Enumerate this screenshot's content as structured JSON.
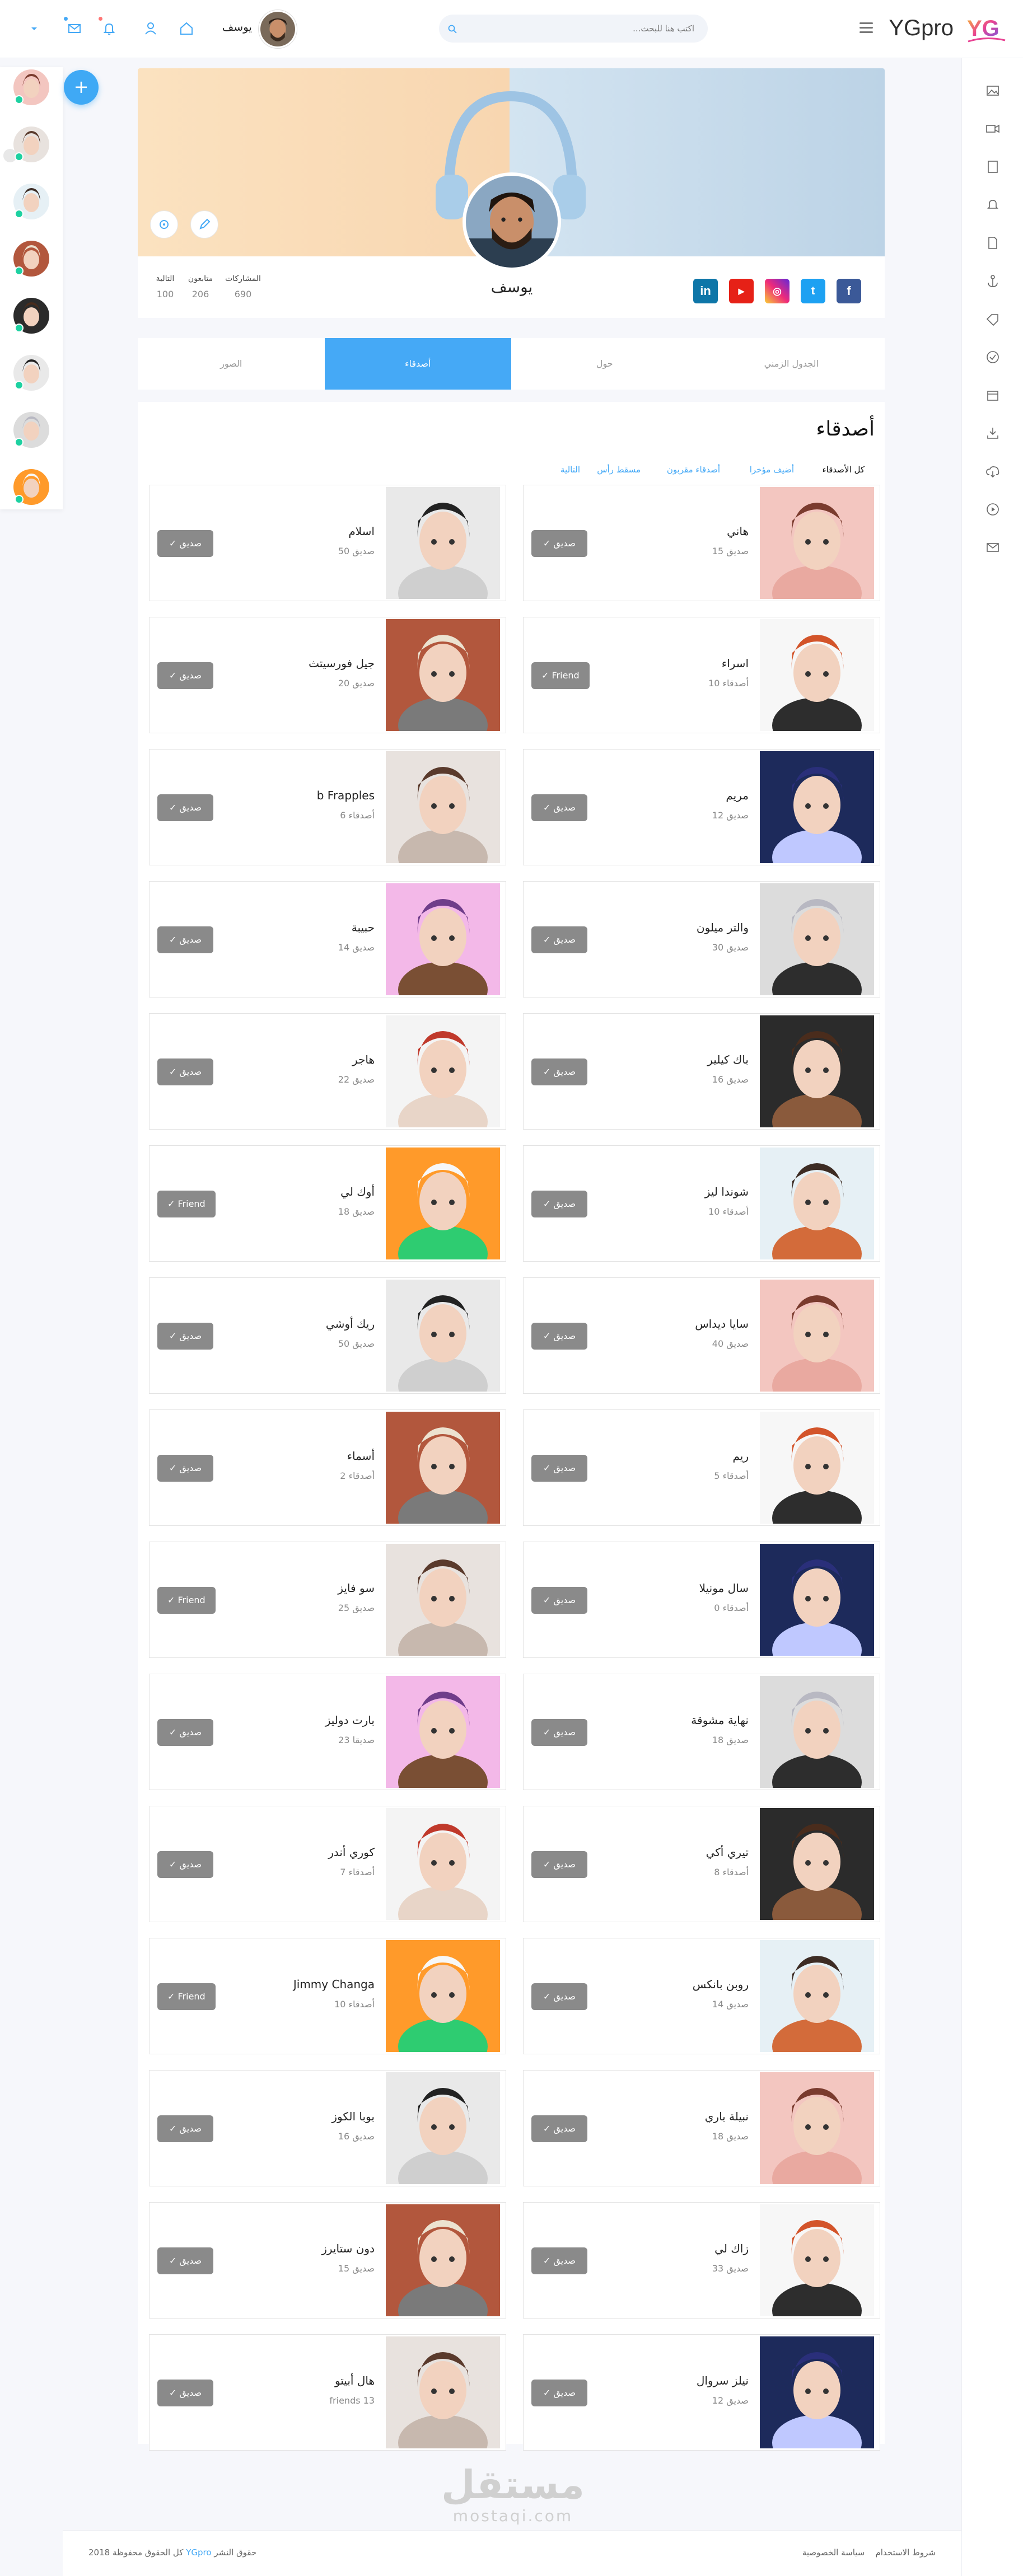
{
  "brand": {
    "name": "YGpro",
    "logo_letters": "YG"
  },
  "search": {
    "placeholder": "اكتب هنا للبحث..."
  },
  "top_user": {
    "name": "يوسف"
  },
  "profile": {
    "name": "يوسف",
    "stats": [
      {
        "label": "المشاركات",
        "value": "690"
      },
      {
        "label": "متابعون",
        "value": "206"
      },
      {
        "label": "التالية",
        "value": "100"
      }
    ],
    "socials": [
      "linkedin-icon",
      "youtube-icon",
      "instagram-icon",
      "twitter-icon",
      "facebook-icon"
    ]
  },
  "tabs": [
    {
      "label": "الجدول الزمني"
    },
    {
      "label": "حول"
    },
    {
      "label": "أصدقاء"
    },
    {
      "label": "الصور"
    }
  ],
  "friends": {
    "title": "أصدقاء",
    "filters": [
      {
        "label": "كل الأصدقاء"
      },
      {
        "label": "أضيف مؤخرا"
      },
      {
        "label": "أصدقاء مقربون"
      },
      {
        "label": "مسقط رأس"
      },
      {
        "label": "التالية"
      }
    ],
    "cards": [
      {
        "name": "هاني",
        "count": "15 صديق",
        "button": "صديق"
      },
      {
        "name": "اسلام",
        "count": "50 صديق",
        "button": "صديق"
      },
      {
        "name": "اسراء",
        "count": "10 أصدقاء",
        "button": "Friend"
      },
      {
        "name": "جيل فورسيتث",
        "count": "20 صديق",
        "button": "صديق"
      },
      {
        "name": "مريم",
        "count": "12 صديق",
        "button": "صديق"
      },
      {
        "name": "b Frapples",
        "count": "6 أصدقاء",
        "button": "صديق"
      },
      {
        "name": "والتر ميلون",
        "count": "30 صديق",
        "button": "صديق"
      },
      {
        "name": "حبيبة",
        "count": "14 صديق",
        "button": "صديق"
      },
      {
        "name": "باك كيلير",
        "count": "16 صديق",
        "button": "صديق"
      },
      {
        "name": "هاجر",
        "count": "22 صديق",
        "button": "صديق"
      },
      {
        "name": "شوندا ليز",
        "count": "10 أصدقاء",
        "button": "صديق"
      },
      {
        "name": "أوك لي",
        "count": "18 صديق",
        "button": "Friend"
      },
      {
        "name": "سايا ديداس",
        "count": "40 صديق",
        "button": "صديق"
      },
      {
        "name": "ريك أوشي",
        "count": "50 صديق",
        "button": "صديق"
      },
      {
        "name": "ريم",
        "count": "5 أصدقاء",
        "button": "صديق"
      },
      {
        "name": "أسماء",
        "count": "2 أصدقاء",
        "button": "صديق"
      },
      {
        "name": "سال مونيلا",
        "count": "0 أصدقاء",
        "button": "صديق"
      },
      {
        "name": "سو فايز",
        "count": "25 صديق",
        "button": "Friend"
      },
      {
        "name": "نهاية مشوقة",
        "count": "18 صديق",
        "button": "صديق"
      },
      {
        "name": "بارت دوليز",
        "count": "23 صديقا",
        "button": "صديق"
      },
      {
        "name": "تيري أكي",
        "count": "8 أصدقاء",
        "button": "صديق"
      },
      {
        "name": "كوري أندر",
        "count": "7 أصدقاء",
        "button": "صديق"
      },
      {
        "name": "روبن بانكس",
        "count": "14 صديق",
        "button": "صديق"
      },
      {
        "name": "Jimmy Changa",
        "count": "10 أصدقاء",
        "button": "Friend"
      },
      {
        "name": "نبيلة باري",
        "count": "18 صديق",
        "button": "صديق"
      },
      {
        "name": "بوبا الكوز",
        "count": "16 صديق",
        "button": "صديق"
      },
      {
        "name": "زاك لي",
        "count": "33 صديق",
        "button": "صديق"
      },
      {
        "name": "دون ستايرز",
        "count": "15 صديق",
        "button": "صديق"
      },
      {
        "name": "نيلز سروال",
        "count": "12 صديق",
        "button": "صديق"
      },
      {
        "name": "هال أبيتو",
        "count": "friends 13",
        "button": "صديق"
      }
    ]
  },
  "watermark": {
    "arabic": "مستقل",
    "latin": "mostaqi.com"
  },
  "footer": {
    "rights": "حقوق النشر",
    "year": "2018",
    "brand": "YGpro",
    "rights_suffix": "كل الحقوق محفوظة",
    "privacy": "سياسة الخصوصية",
    "terms": "شروط الاستخدام"
  },
  "colors": {
    "accent": "#45a9f6",
    "online": "#1dd1a1",
    "button": "#8a8a8a"
  }
}
